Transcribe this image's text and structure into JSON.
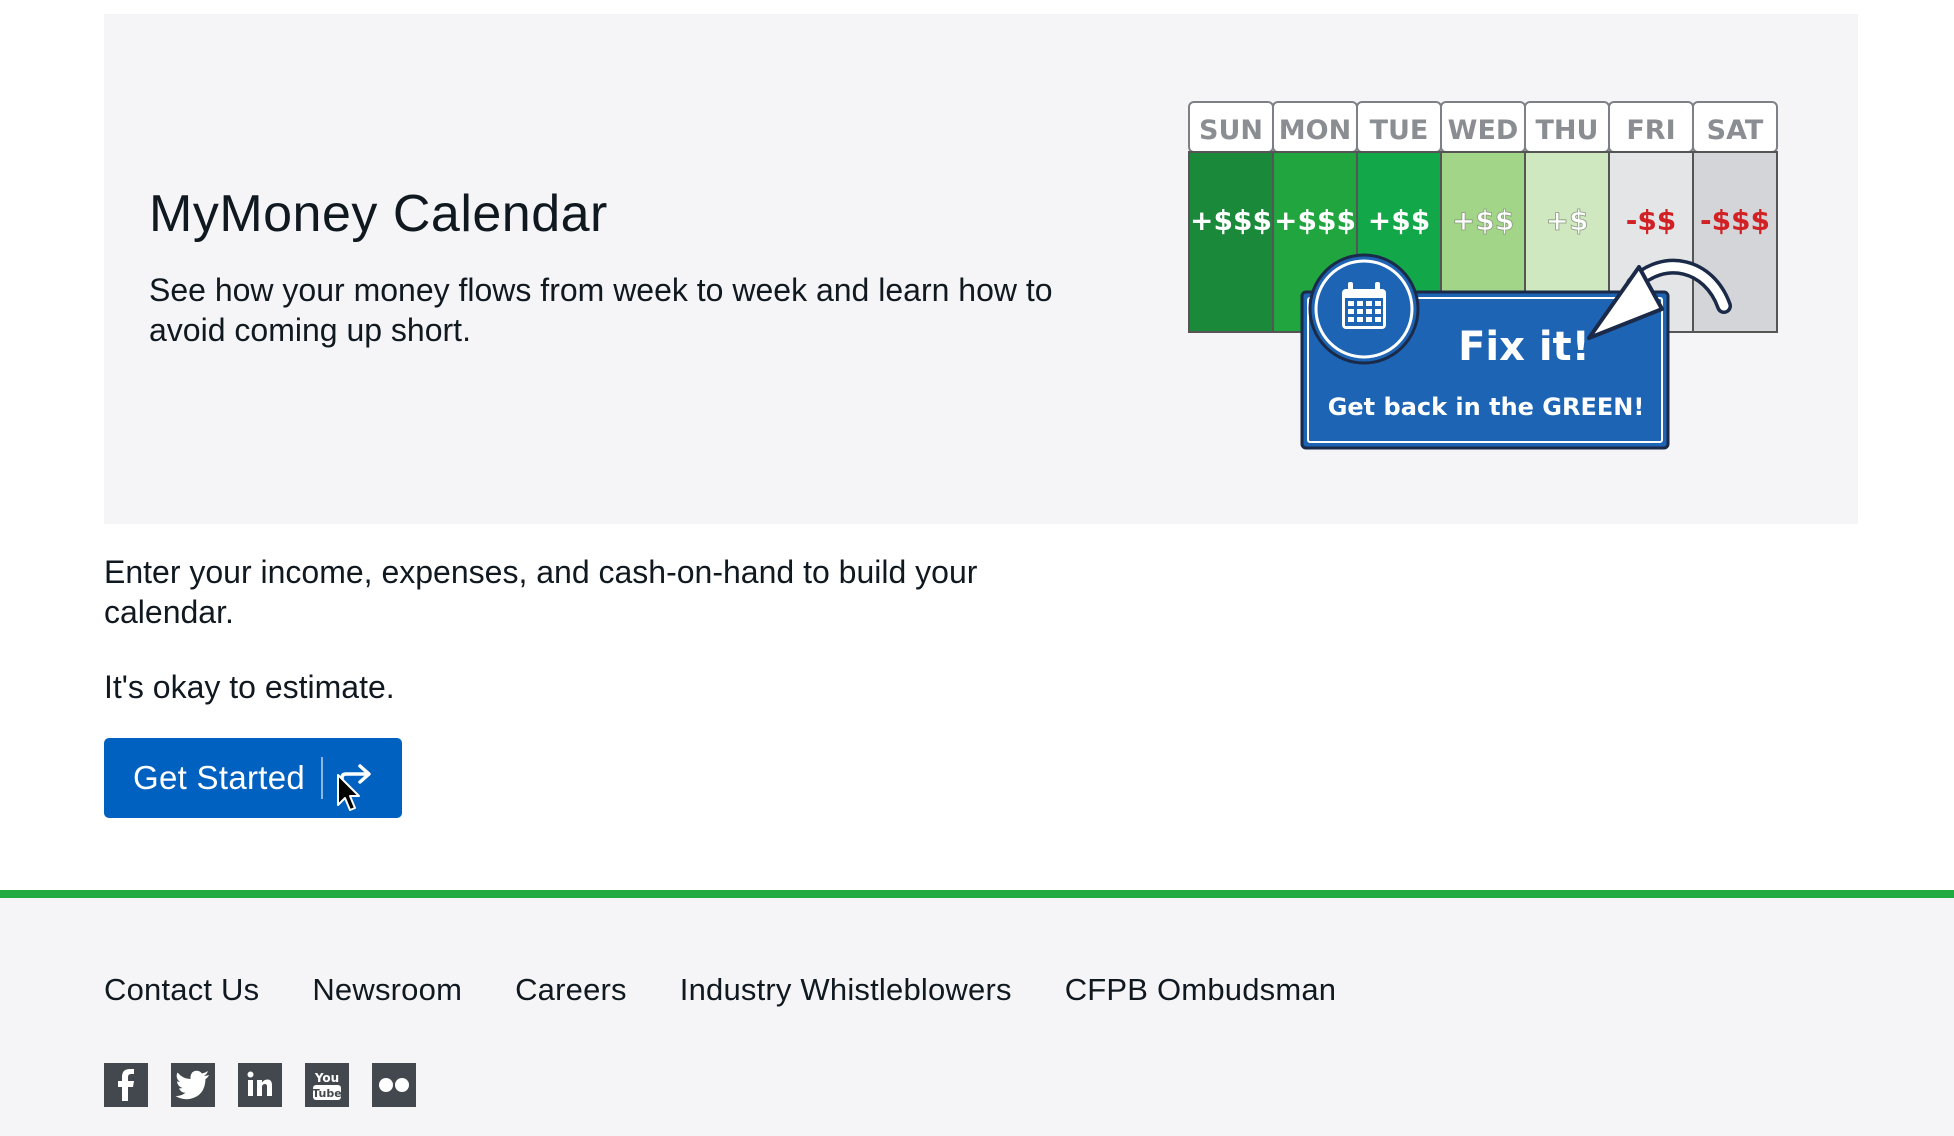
{
  "hero": {
    "title": "MyMoney Calendar",
    "description": "See how your money flows from week to week and learn how to avoid coming up short."
  },
  "illustration": {
    "days": [
      "SUN",
      "MON",
      "TUE",
      "WED",
      "THU",
      "FRI",
      "SAT"
    ],
    "amounts": [
      "+$$$",
      "+$$$",
      "+$$",
      "+$$",
      "+$",
      "-$$",
      "-$$$"
    ],
    "fix_title": "Fix it!",
    "fix_subtitle": "Get back in the GREEN!",
    "icon": "calendar-icon"
  },
  "main": {
    "intro": "Enter your income, expenses, and cash-on-hand to build your calendar.",
    "estimate": "It's okay to estimate.",
    "get_started_label": "Get Started"
  },
  "footer": {
    "links": [
      "Contact Us",
      "Newsroom",
      "Careers",
      "Industry Whistleblowers",
      "CFPB Ombudsman"
    ],
    "social_icons": [
      "facebook-icon",
      "twitter-icon",
      "linkedin-icon",
      "youtube-icon",
      "flickr-icon"
    ]
  },
  "colors": {
    "primary_button": "#0061c1",
    "footer_accent": "#20aa3f",
    "hero_background": "#f5f5f7",
    "negative_amount": "#d12124"
  }
}
